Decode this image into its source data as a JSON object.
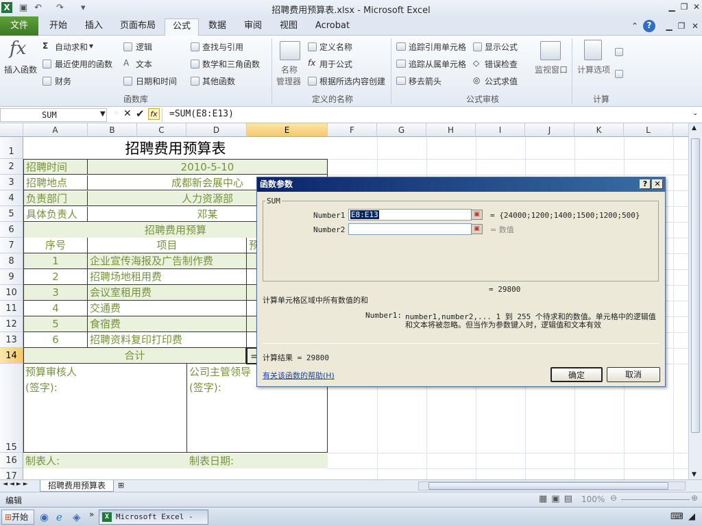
{
  "window": {
    "title": "招聘费用预算表.xlsx - Microsoft Excel"
  },
  "ribbon_tabs": [
    "文件",
    "开始",
    "插入",
    "页面布局",
    "公式",
    "数据",
    "审阅",
    "视图",
    "Acrobat"
  ],
  "ribbon": {
    "insert_function": "插入函数",
    "autosum": "自动求和",
    "recent": "最近使用的函数",
    "financial": "财务",
    "logical": "逻辑",
    "text": "文本",
    "datetime": "日期和时间",
    "lookup": "查找与引用",
    "math": "数学和三角函数",
    "other": "其他函数",
    "group_library": "函数库",
    "name_mgr_1": "名称",
    "name_mgr_2": "管理器",
    "define_name": "定义名称",
    "use_in_formula": "用于公式",
    "create_from_sel": "根据所选内容创建",
    "group_names": "定义的名称",
    "trace_prec": "追踪引用单元格",
    "trace_dep": "追踪从属单元格",
    "remove_arrows": "移去箭头",
    "show_formulas": "显示公式",
    "error_check": "错误检查",
    "evaluate": "公式求值",
    "watch": "监视窗口",
    "group_audit": "公式审核",
    "calc_options": "计算选项",
    "group_calc": "计算"
  },
  "formula_bar": {
    "name_box": "SUM",
    "formula": "=SUM(E8:E13)"
  },
  "columns": [
    "A",
    "B",
    "C",
    "D",
    "E",
    "F",
    "G",
    "H",
    "I",
    "J",
    "K",
    "L"
  ],
  "rows": [
    "1",
    "2",
    "3",
    "4",
    "5",
    "6",
    "7",
    "8",
    "9",
    "10",
    "11",
    "12",
    "13",
    "14",
    "15",
    "16",
    "17"
  ],
  "sheet": {
    "title": "招聘费用预算表",
    "time_label": "招聘时间",
    "time_value": "2010-5-10",
    "place_label": "招聘地点",
    "place_value": "成都新会展中心",
    "dept_label": "负责部门",
    "dept_value": "人力资源部",
    "owner_label": "具体负责人",
    "owner_value": "邓某",
    "budget_header": "招聘费用预算",
    "col_no": "序号",
    "col_item": "项目",
    "col_budget_partial": "预",
    "items": [
      {
        "no": "1",
        "name": "企业宣传海报及广告制作费"
      },
      {
        "no": "2",
        "name": "招聘场地租用费"
      },
      {
        "no": "3",
        "name": "会议室租用费"
      },
      {
        "no": "4",
        "name": "交通费"
      },
      {
        "no": "5",
        "name": "食宿费"
      },
      {
        "no": "6",
        "name": "招聘资料复印打印费"
      }
    ],
    "total_label": "合计",
    "total_partial": "=",
    "reviewer": "预算审核人",
    "leader": "公司主管领导",
    "sign": "(签字):",
    "maker": "制表人:",
    "make_date": "制表日期:"
  },
  "dialog": {
    "title": "函数参数",
    "func": "SUM",
    "arg1_label": "Number1",
    "arg1_value": "E8:E13",
    "arg1_result": "= {24000;1200;1400;1500;1200;500}",
    "arg2_label": "Number2",
    "arg2_result": "= 数值",
    "total": "= 29800",
    "desc": "计算单元格区域中所有数值的和",
    "help_label": "Number1:",
    "help_text_1": "number1,number2,... 1 到 255 个待求和的数值。单元格中的逻辑值",
    "help_text_2": "和文本将被忽略。但当作为参数键入时，逻辑值和文本有效",
    "result": "计算结果 = 29800",
    "help_link": "有关该函数的帮助(H)",
    "ok": "确定",
    "cancel": "取消"
  },
  "sheet_tab": "招聘费用预算表",
  "status": {
    "mode": "编辑",
    "zoom": "100%"
  },
  "taskbar": {
    "start": "开始",
    "app": "Microsoft Excel - ..."
  }
}
